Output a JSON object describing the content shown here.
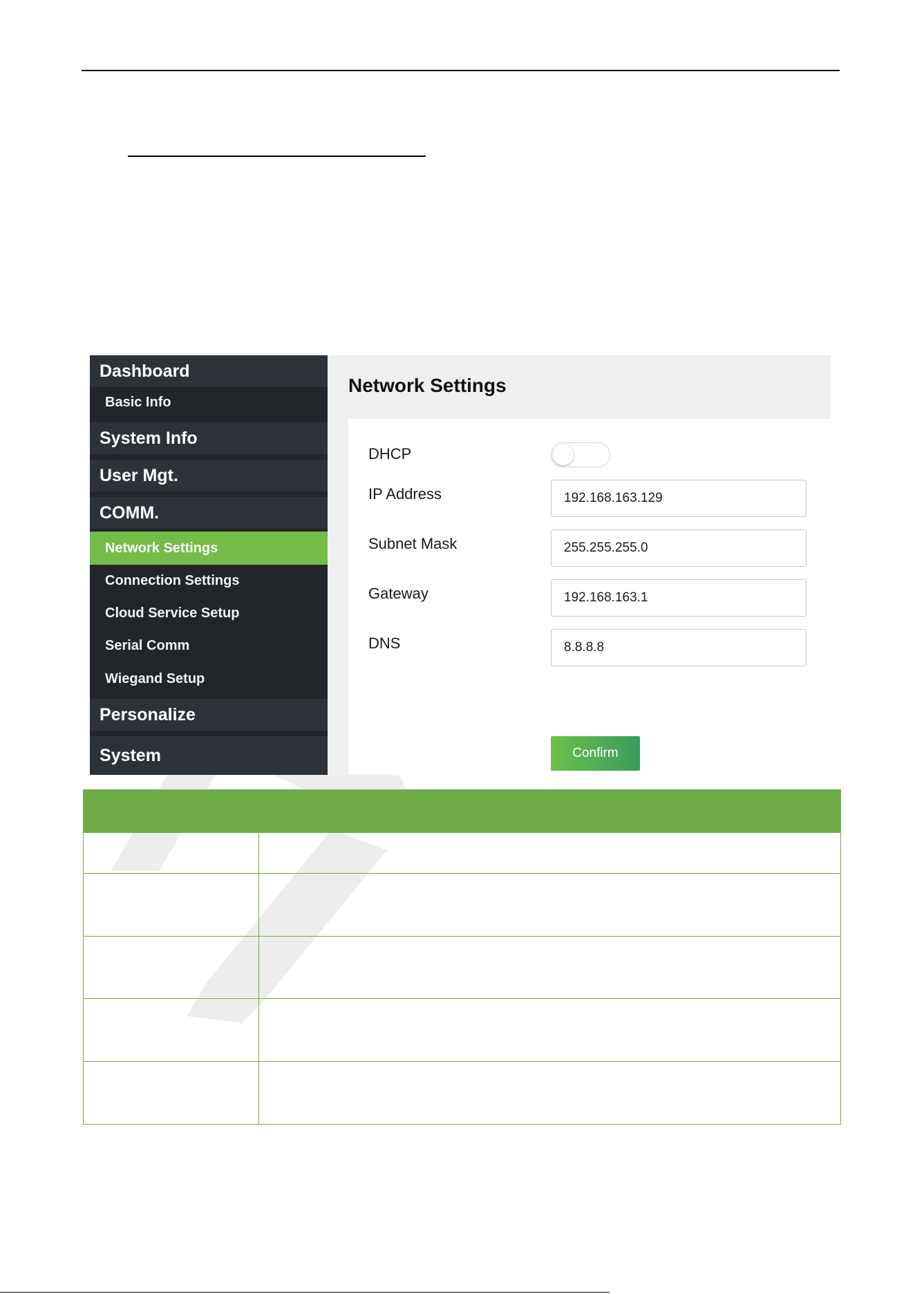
{
  "sidebar": {
    "items": [
      {
        "label": "Dashboard"
      },
      {
        "label": "Basic Info"
      },
      {
        "label": "System Info"
      },
      {
        "label": "User Mgt."
      },
      {
        "label": "COMM."
      },
      {
        "label": "Network Settings"
      },
      {
        "label": "Connection Settings"
      },
      {
        "label": "Cloud Service Setup"
      },
      {
        "label": "Serial Comm"
      },
      {
        "label": "Wiegand Setup"
      },
      {
        "label": "Personalize"
      },
      {
        "label": "System"
      }
    ],
    "active_item": "Network Settings"
  },
  "main": {
    "title": "Network Settings",
    "dhcp": {
      "label": "DHCP",
      "enabled": false
    },
    "fields": [
      {
        "label": "IP Address",
        "value": "192.168.163.129"
      },
      {
        "label": "Subnet Mask",
        "value": "255.255.255.0"
      },
      {
        "label": "Gateway",
        "value": "192.168.163.1"
      },
      {
        "label": "DNS",
        "value": "8.8.8.8"
      }
    ],
    "confirm_label": "Confirm"
  },
  "colors": {
    "accent_green": "#74bb48",
    "table_header_green": "#71ad47",
    "sidebar_bg": "#22262b"
  }
}
